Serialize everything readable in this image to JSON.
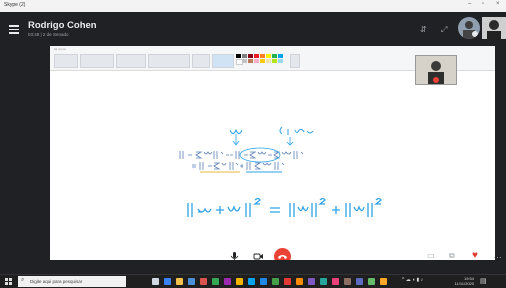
{
  "titlebar": {
    "app_name": "Skype (2)",
    "minimize": "–",
    "maximize": "▫",
    "close": "×"
  },
  "header": {
    "name": "Rodrigo Cohen",
    "subtitle": "03:48 | 2 de Senado"
  },
  "callbar": {
    "more": "…"
  },
  "taskbar": {
    "search_placeholder": "Digite aqui para pesquisar",
    "time": "19:54",
    "date": "11/11/2020"
  },
  "colors": {
    "background": "#202124",
    "end_call": "#ea4335",
    "heart": "#e03c31",
    "ink": "#2ea3e6"
  }
}
